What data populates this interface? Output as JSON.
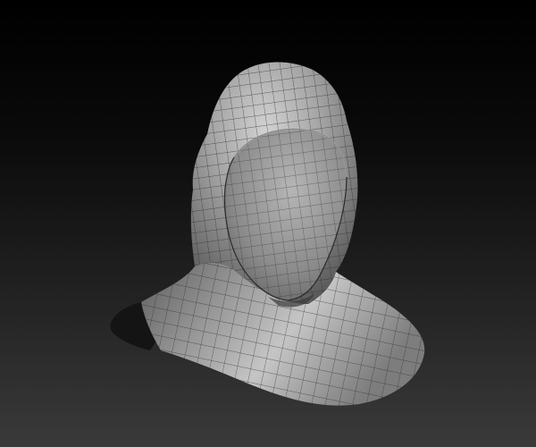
{
  "viewport": {
    "background_top": "#000000",
    "background_bottom": "#3a3a3a",
    "mesh_color": "#8a8a8a",
    "wire_color": "#2b2b2b",
    "inner_color": "#151515"
  },
  "model": {
    "icon": "hooded-bust-mesh-icon",
    "display": "wireframe-shaded"
  }
}
